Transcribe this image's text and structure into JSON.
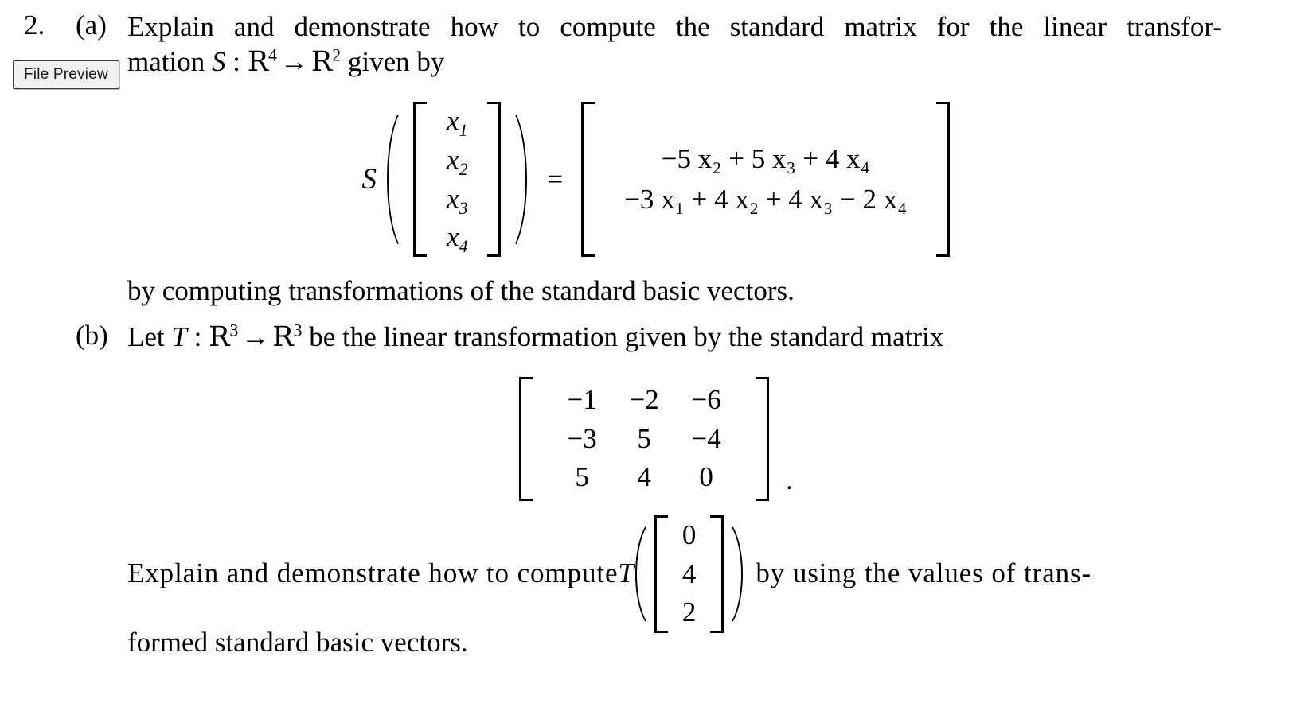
{
  "overlay": {
    "file_preview_label": "File Preview"
  },
  "document": {
    "problem_number": "2.",
    "parts": [
      {
        "label": "(a)",
        "line1": "Explain and demonstrate how to compute the standard matrix for the linear transfor-",
        "line2_prefix": "mation ",
        "transform_name": "S",
        "colon": ":",
        "domain_symbol": "R",
        "domain_exponent": "4",
        "arrow": "→",
        "codomain_symbol": "R",
        "codomain_exponent": "2",
        "line2_suffix": " given by",
        "closing_line": "by computing transformations of the standard basic vectors."
      },
      {
        "label": "(b)",
        "line1_prefix": "Let ",
        "transform_name": "T",
        "colon": ":",
        "domain_symbol": "R",
        "domain_exponent": "3",
        "arrow": "→",
        "codomain_symbol": "R",
        "codomain_exponent": "3",
        "line1_suffix": " be the linear transformation given by the standard matrix",
        "trailing_period": ".",
        "closing_prefix": "Explain and demonstrate how to compute ",
        "closing_transform": "T",
        "closing_suffix": "by using the values of trans-",
        "last_line": "formed standard basic vectors."
      }
    ],
    "equation_S": {
      "function_name": "S",
      "input_vector": [
        "x₁",
        "x₂",
        "x₃",
        "x₄"
      ],
      "input_vector_parts": [
        {
          "base": "x",
          "sub": "1"
        },
        {
          "base": "x",
          "sub": "2"
        },
        {
          "base": "x",
          "sub": "3"
        },
        {
          "base": "x",
          "sub": "4"
        }
      ],
      "equals": "=",
      "output_rows": [
        [
          {
            "text": "−5 "
          },
          {
            "base": "x",
            "sub": "2"
          },
          {
            "text": " + 5 "
          },
          {
            "base": "x",
            "sub": "3"
          },
          {
            "text": " + 4 "
          },
          {
            "base": "x",
            "sub": "4"
          }
        ],
        [
          {
            "text": "−3 "
          },
          {
            "base": "x",
            "sub": "1"
          },
          {
            "text": " + 4 "
          },
          {
            "base": "x",
            "sub": "2"
          },
          {
            "text": " + 4 "
          },
          {
            "base": "x",
            "sub": "3"
          },
          {
            "text": " − 2 "
          },
          {
            "base": "x",
            "sub": "4"
          }
        ]
      ],
      "output_rows_plain": [
        "−5 x₂ + 5 x₃ + 4 x₄",
        "−3 x₁ + 4 x₂ + 4 x₃ − 2 x₄"
      ]
    },
    "standard_matrix_T": {
      "rows": [
        [
          "−1",
          "−2",
          "−6"
        ],
        [
          "−3",
          "5",
          "−4"
        ],
        [
          "5",
          "4",
          "0"
        ]
      ]
    },
    "input_vector_T": [
      "0",
      "4",
      "2"
    ]
  }
}
